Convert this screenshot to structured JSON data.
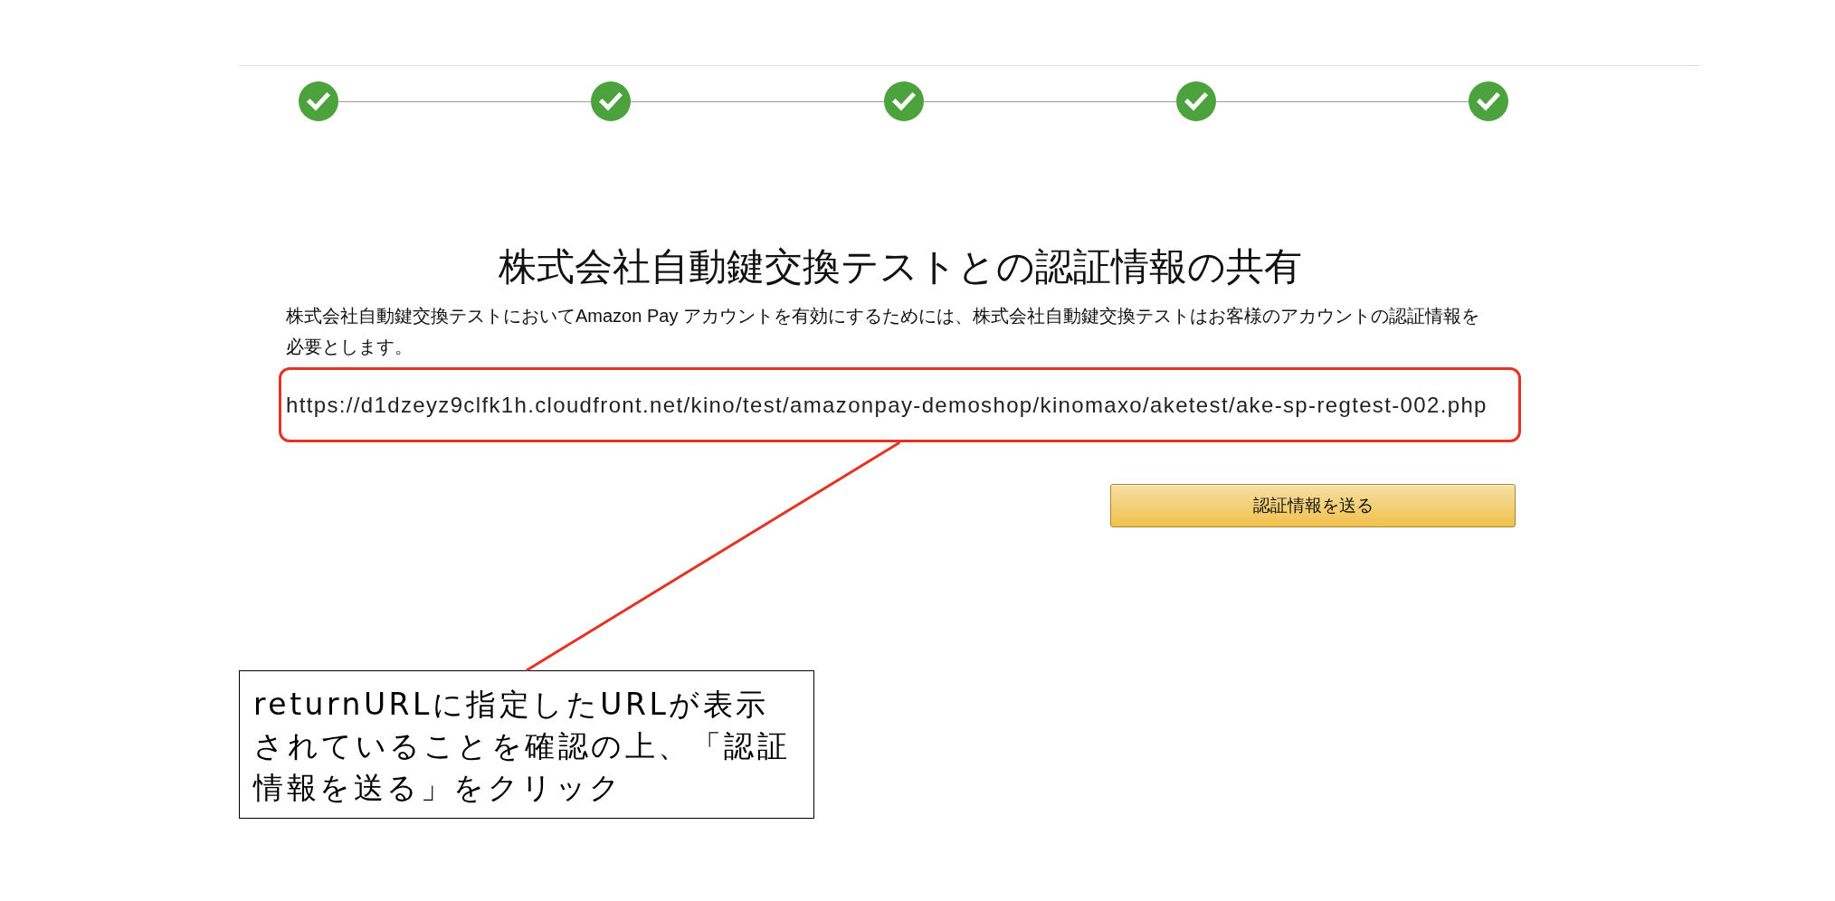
{
  "progress_steps": [
    {
      "completed": true
    },
    {
      "completed": true
    },
    {
      "completed": true
    },
    {
      "completed": true
    },
    {
      "completed": true
    }
  ],
  "heading": "株式会社自動鍵交換テストとの認証情報の共有",
  "description": "株式会社自動鍵交換テストにおいてAmazon Pay アカウントを有効にするためには、株式会社自動鍵交換テストはお客様のアカウントの認証情報を必要とします。",
  "return_url": "https://d1dzeyz9clfk1h.cloudfront.net/kino/test/amazonpay-demoshop/kinomaxo/aketest/ake-sp-regtest-002.php",
  "send_button": {
    "label": "認証情報を送る"
  },
  "annotation": {
    "text": "returnURLに指定したURLが表示されていることを確認の上、「認証情報を送る」をクリック"
  }
}
